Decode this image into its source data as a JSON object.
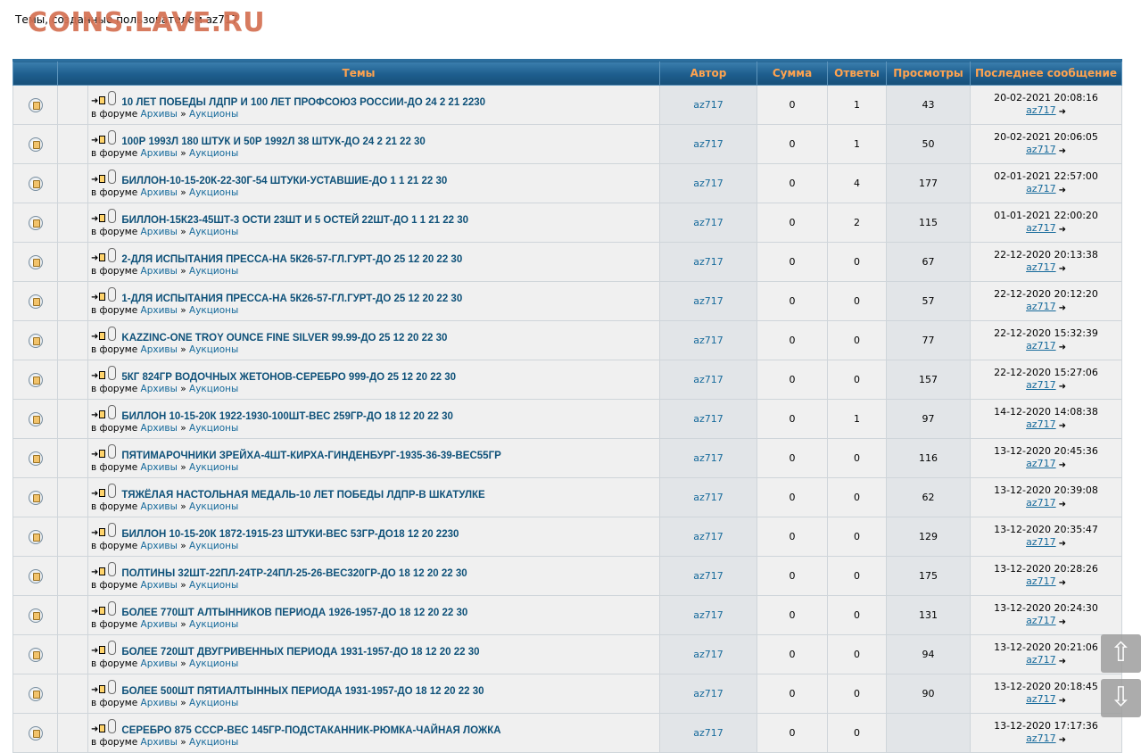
{
  "page": {
    "heading": "Темы, созданные пользователем az717",
    "watermark": "COINS.LAVE.RU"
  },
  "columns": {
    "topics": "Темы",
    "author": "Автор",
    "sum": "Сумма",
    "replies": "Ответы",
    "views": "Просмотры",
    "last_post": "Последнее сообщение"
  },
  "labels": {
    "in_forum": "в форуме",
    "arrow": "»"
  },
  "icons": {
    "topic": "topic-status-icon",
    "newpost": "new-post-icon",
    "attachment": "paperclip-icon",
    "goto_last": "goto-last-post-icon",
    "scroll_up": "arrow-up-icon",
    "scroll_down": "arrow-down-icon"
  },
  "scroll": {
    "up": "⇧",
    "down": "⇩"
  },
  "rows": [
    {
      "title": "10 ЛЕТ ПОБЕДЫ ЛДПР И 100 ЛЕТ ПРОФСОЮЗ РОССИИ-ДО 24 2 21 2230",
      "forum1": "Архивы",
      "forum2": "Аукционы",
      "author": "az717",
      "sum": "0",
      "replies": "1",
      "views": "43",
      "last_date": "20-02-2021 20:08:16",
      "last_author": "az717"
    },
    {
      "title": "100Р 1993Л 180 ШТУК И 50Р 1992Л 38 ШТУК-ДО 24 2 21 22 30",
      "forum1": "Архивы",
      "forum2": "Аукционы",
      "author": "az717",
      "sum": "0",
      "replies": "1",
      "views": "50",
      "last_date": "20-02-2021 20:06:05",
      "last_author": "az717"
    },
    {
      "title": "БИЛЛОН-10-15-20К-22-30Г-54 ШТУКИ-УСТАВШИЕ-ДО 1 1 21 22 30",
      "forum1": "Архивы",
      "forum2": "Аукционы",
      "author": "az717",
      "sum": "0",
      "replies": "4",
      "views": "177",
      "last_date": "02-01-2021 22:57:00",
      "last_author": "az717"
    },
    {
      "title": "БИЛЛОН-15К23-45ШТ-3 ОСТИ 23ШТ И 5 ОСТЕЙ 22ШТ-ДО 1 1 21 22 30",
      "forum1": "Архивы",
      "forum2": "Аукционы",
      "author": "az717",
      "sum": "0",
      "replies": "2",
      "views": "115",
      "last_date": "01-01-2021 22:00:20",
      "last_author": "az717"
    },
    {
      "title": "2-ДЛЯ ИСПЫТАНИЯ ПРЕССА-НА 5К26-57-ГЛ.ГУРТ-ДО 25 12 20 22 30",
      "forum1": "Архивы",
      "forum2": "Аукционы",
      "author": "az717",
      "sum": "0",
      "replies": "0",
      "views": "67",
      "last_date": "22-12-2020 20:13:38",
      "last_author": "az717"
    },
    {
      "title": "1-ДЛЯ ИСПЫТАНИЯ ПРЕССА-НА 5К26-57-ГЛ.ГУРТ-ДО 25 12 20 22 30",
      "forum1": "Архивы",
      "forum2": "Аукционы",
      "author": "az717",
      "sum": "0",
      "replies": "0",
      "views": "57",
      "last_date": "22-12-2020 20:12:20",
      "last_author": "az717"
    },
    {
      "title": "KAZZINC-ONE TROY OUNCE FINE SILVER 99.99-ДО 25 12 20 22 30",
      "forum1": "Архивы",
      "forum2": "Аукционы",
      "author": "az717",
      "sum": "0",
      "replies": "0",
      "views": "77",
      "last_date": "22-12-2020 15:32:39",
      "last_author": "az717"
    },
    {
      "title": "5КГ 824ГР ВОДОЧНЫХ ЖЕТОНОВ-СЕРЕБРО 999-ДО 25 12 20 22 30",
      "forum1": "Архивы",
      "forum2": "Аукционы",
      "author": "az717",
      "sum": "0",
      "replies": "0",
      "views": "157",
      "last_date": "22-12-2020 15:27:06",
      "last_author": "az717"
    },
    {
      "title": "БИЛЛОН 10-15-20К 1922-1930-100ШТ-ВЕС 259ГР-ДО 18 12 20 22 30",
      "forum1": "Архивы",
      "forum2": "Аукционы",
      "author": "az717",
      "sum": "0",
      "replies": "1",
      "views": "97",
      "last_date": "14-12-2020 14:08:38",
      "last_author": "az717"
    },
    {
      "title": "ПЯТИМАРОЧНИКИ ЗРЕЙХА-4ШТ-КИРХА-ГИНДЕНБУРГ-1935-36-39-ВЕС55ГР",
      "forum1": "Архивы",
      "forum2": "Аукционы",
      "author": "az717",
      "sum": "0",
      "replies": "0",
      "views": "116",
      "last_date": "13-12-2020 20:45:36",
      "last_author": "az717"
    },
    {
      "title": "ТЯЖЁЛАЯ НАСТОЛЬНАЯ МЕДАЛЬ-10 ЛЕТ ПОБЕДЫ ЛДПР-В ШКАТУЛКЕ",
      "forum1": "Архивы",
      "forum2": "Аукционы",
      "author": "az717",
      "sum": "0",
      "replies": "0",
      "views": "62",
      "last_date": "13-12-2020 20:39:08",
      "last_author": "az717"
    },
    {
      "title": "БИЛЛОН 10-15-20К 1872-1915-23 ШТУКИ-ВЕС 53ГР-ДО18 12 20 2230",
      "forum1": "Архивы",
      "forum2": "Аукционы",
      "author": "az717",
      "sum": "0",
      "replies": "0",
      "views": "129",
      "last_date": "13-12-2020 20:35:47",
      "last_author": "az717"
    },
    {
      "title": "ПОЛТИНЫ 32ШТ-22ПЛ-24ТР-24ПЛ-25-26-ВЕС320ГР-ДО 18 12 20 22 30",
      "forum1": "Архивы",
      "forum2": "Аукционы",
      "author": "az717",
      "sum": "0",
      "replies": "0",
      "views": "175",
      "last_date": "13-12-2020 20:28:26",
      "last_author": "az717"
    },
    {
      "title": "БОЛЕЕ 770ШТ АЛТЫННИКОВ ПЕРИОДА 1926-1957-ДО 18 12 20 22 30",
      "forum1": "Архивы",
      "forum2": "Аукционы",
      "author": "az717",
      "sum": "0",
      "replies": "0",
      "views": "131",
      "last_date": "13-12-2020 20:24:30",
      "last_author": "az717"
    },
    {
      "title": "БОЛЕЕ 720ШТ ДВУГРИВЕННЫХ ПЕРИОДА 1931-1957-ДО 18 12 20 22 30",
      "forum1": "Архивы",
      "forum2": "Аукционы",
      "author": "az717",
      "sum": "0",
      "replies": "0",
      "views": "94",
      "last_date": "13-12-2020 20:21:06",
      "last_author": "az717"
    },
    {
      "title": "БОЛЕЕ 500ШТ ПЯТИАЛТЫННЫХ ПЕРИОДА 1931-1957-ДО 18 12 20 22 30",
      "forum1": "Архивы",
      "forum2": "Аукционы",
      "author": "az717",
      "sum": "0",
      "replies": "0",
      "views": "90",
      "last_date": "13-12-2020 20:18:45",
      "last_author": "az717"
    },
    {
      "title": "СЕРЕБРО 875 СССР-ВЕС 145ГР-ПОДСТАКАННИК-РЮМКА-ЧАЙНАЯ ЛОЖКА",
      "forum1": "Архивы",
      "forum2": "Аукционы",
      "author": "az717",
      "sum": "0",
      "replies": "0",
      "views": "",
      "last_date": "13-12-2020 17:17:36",
      "last_author": "az717"
    }
  ]
}
